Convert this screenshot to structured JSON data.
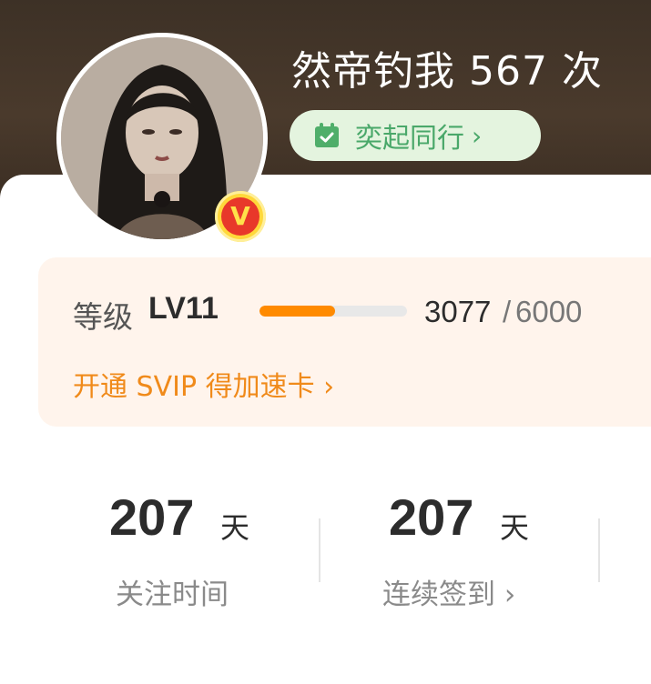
{
  "profile": {
    "username": "然帝钓我 567 次",
    "tag_label": "奕起同行",
    "tag_chevron": "›",
    "avatar_icon": "user-avatar-photo",
    "verified_mark": "V"
  },
  "level": {
    "prefix": "等级",
    "value": "LV11",
    "current": "3077",
    "separator": "/",
    "max": "6000",
    "progress_fraction": 0.5128,
    "upgrade_link": "开通 SVIP 得加速卡 ›"
  },
  "stats": [
    {
      "number": "207",
      "unit": "天",
      "label": "关注时间"
    },
    {
      "number": "207",
      "unit": "天",
      "label": "连续签到 ›"
    }
  ],
  "colors": {
    "header_bg": "#3d3126",
    "tag_bg": "#e4f4df",
    "tag_fg": "#4aa86a",
    "level_bg": "#fff4ec",
    "progress": "#ff8a00",
    "link": "#f08a1a",
    "badge_outer": "#ffd83a",
    "badge_inner": "#e8382a"
  }
}
